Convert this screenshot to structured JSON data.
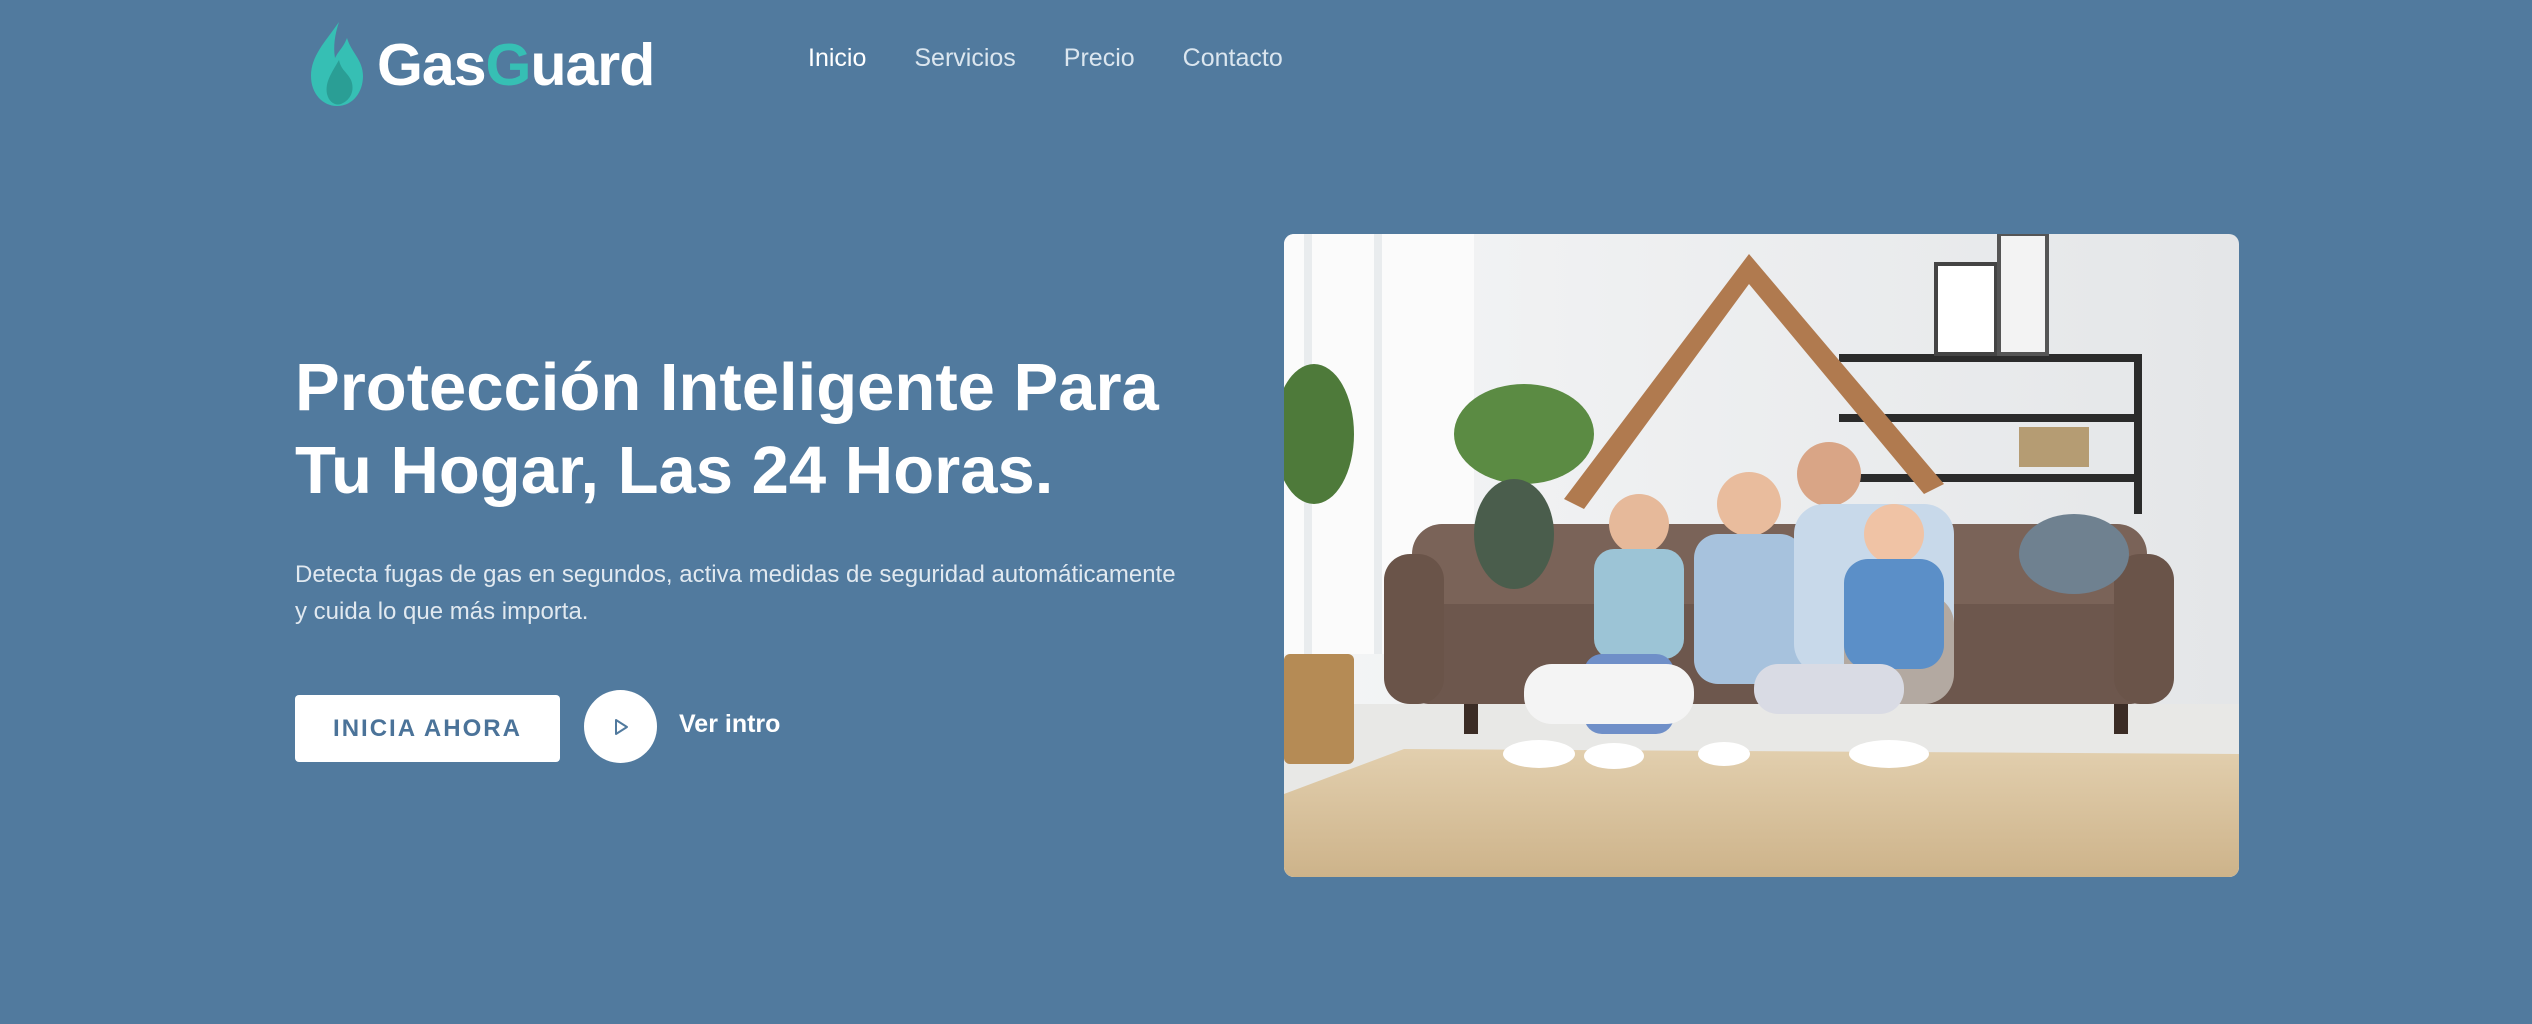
{
  "brand": {
    "name_part1": "Gas",
    "name_part2_accent": "G",
    "name_part3": "uard",
    "accent_color": "#36bfb4"
  },
  "nav": {
    "items": [
      {
        "label": "Inicio",
        "active": true
      },
      {
        "label": "Servicios",
        "active": false
      },
      {
        "label": "Precio",
        "active": false
      },
      {
        "label": "Contacto",
        "active": false
      }
    ]
  },
  "hero": {
    "title_line1": "Protección Inteligente Para",
    "title_line2": "Tu Hogar, Las 24 Horas.",
    "subtitle_line1": "Detecta fugas de gas en segundos, activa medidas de seguridad automáticamente",
    "subtitle_line2": "y cuida lo que más importa.",
    "cta_label": "INICIA AHORA",
    "intro_label": "Ver intro"
  },
  "colors": {
    "background": "#517a9e",
    "button_text": "#4b7399"
  },
  "icons": {
    "logo": "flame-icon",
    "play": "play-icon"
  }
}
